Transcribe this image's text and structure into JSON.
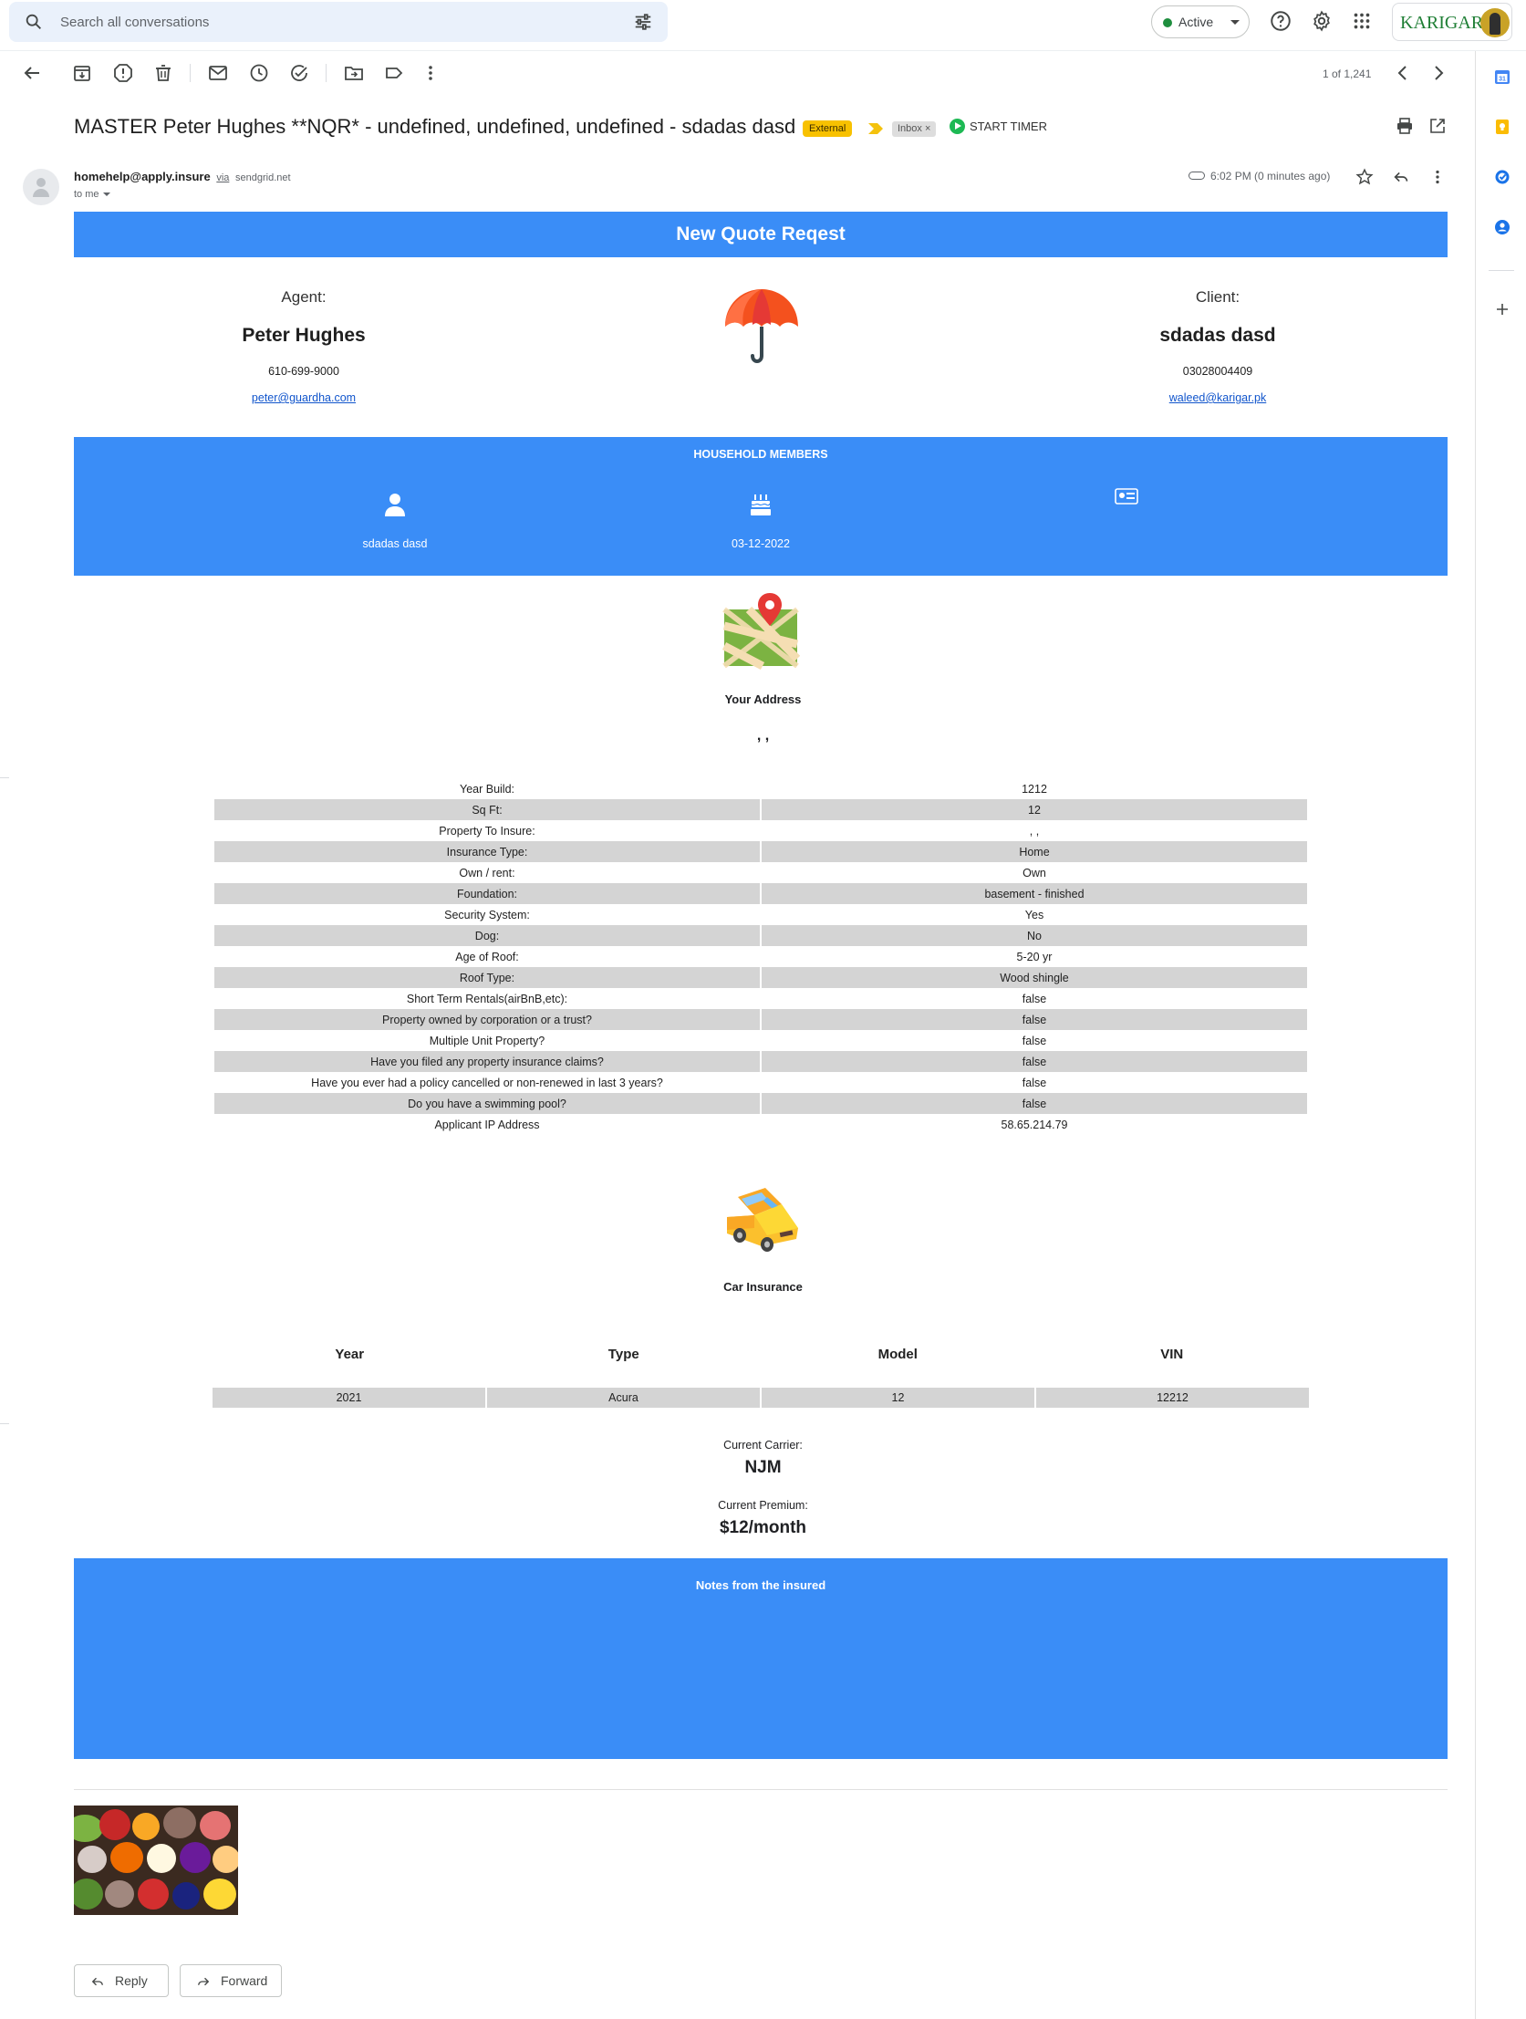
{
  "search": {
    "placeholder": "Search all conversations"
  },
  "status": {
    "label": "Active"
  },
  "account": {
    "brand": "KARIGAR"
  },
  "toolbar": {
    "pager": "1 of 1,241"
  },
  "message": {
    "subject": "MASTER Peter Hughes **NQR* - undefined, undefined, undefined - sdadas dasd",
    "external_label": "External",
    "inbox_label": "Inbox ×",
    "timer_label": "START TIMER",
    "sender_email": "homehelp@apply.insure",
    "via_label": "via",
    "via_domain": "sendgrid.net",
    "to_label": "to me",
    "time": "6:02 PM (0 minutes ago)"
  },
  "quote": {
    "banner": "New Quote Reqest",
    "agent": {
      "role": "Agent:",
      "name": "Peter Hughes",
      "phone": "610-699-9000",
      "email": "peter@guardha.com"
    },
    "client": {
      "role": "Client:",
      "name": "sdadas dasd",
      "phone": "03028004409",
      "email": "waleed@karigar.pk"
    },
    "household": {
      "header": "HOUSEHOLD MEMBERS",
      "member_name": "sdadas dasd",
      "member_dob": "03-12-2022"
    },
    "address": {
      "label": "Your Address",
      "value": ", ,"
    },
    "property_rows": [
      {
        "label": "Year Build:",
        "value": "1212"
      },
      {
        "label": "Sq Ft:",
        "value": "12"
      },
      {
        "label": "Property To Insure:",
        "value": ", ,"
      },
      {
        "label": "Insurance Type:",
        "value": "Home"
      },
      {
        "label": "Own / rent:",
        "value": "Own"
      },
      {
        "label": "Foundation:",
        "value": "basement - finished"
      },
      {
        "label": "Security System:",
        "value": "Yes"
      },
      {
        "label": "Dog:",
        "value": "No"
      },
      {
        "label": "Age of Roof:",
        "value": "5-20 yr"
      },
      {
        "label": "Roof Type:",
        "value": "Wood shingle"
      },
      {
        "label": "Short Term Rentals(airBnB,etc):",
        "value": "false"
      },
      {
        "label": "Property owned by corporation or a trust?",
        "value": "false"
      },
      {
        "label": "Multiple Unit Property?",
        "value": "false"
      },
      {
        "label": "Have you filed any property insurance claims?",
        "value": "false"
      },
      {
        "label": "Have you ever had a policy cancelled or non-renewed in last 3 years?",
        "value": "false"
      },
      {
        "label": "Do you have a swimming pool?",
        "value": "false"
      },
      {
        "label": "Applicant IP Address",
        "value": "58.65.214.79"
      }
    ],
    "car": {
      "label": "Car Insurance",
      "headers": [
        "Year",
        "Type",
        "Model",
        "VIN"
      ],
      "row": [
        "2021",
        "Acura",
        "12",
        "12212"
      ]
    },
    "carrier_label": "Current Carrier:",
    "carrier_value": "NJM",
    "premium_label": "Current Premium:",
    "premium_value": "$12/month",
    "notes_header": "Notes from the insured"
  },
  "actions": {
    "reply": "Reply",
    "forward": "Forward"
  },
  "colors": {
    "banner": "#3a8df7",
    "row_gray": "#d4d4d4",
    "external_chip": "#f8c100",
    "active_dot": "#1e8e3e"
  }
}
